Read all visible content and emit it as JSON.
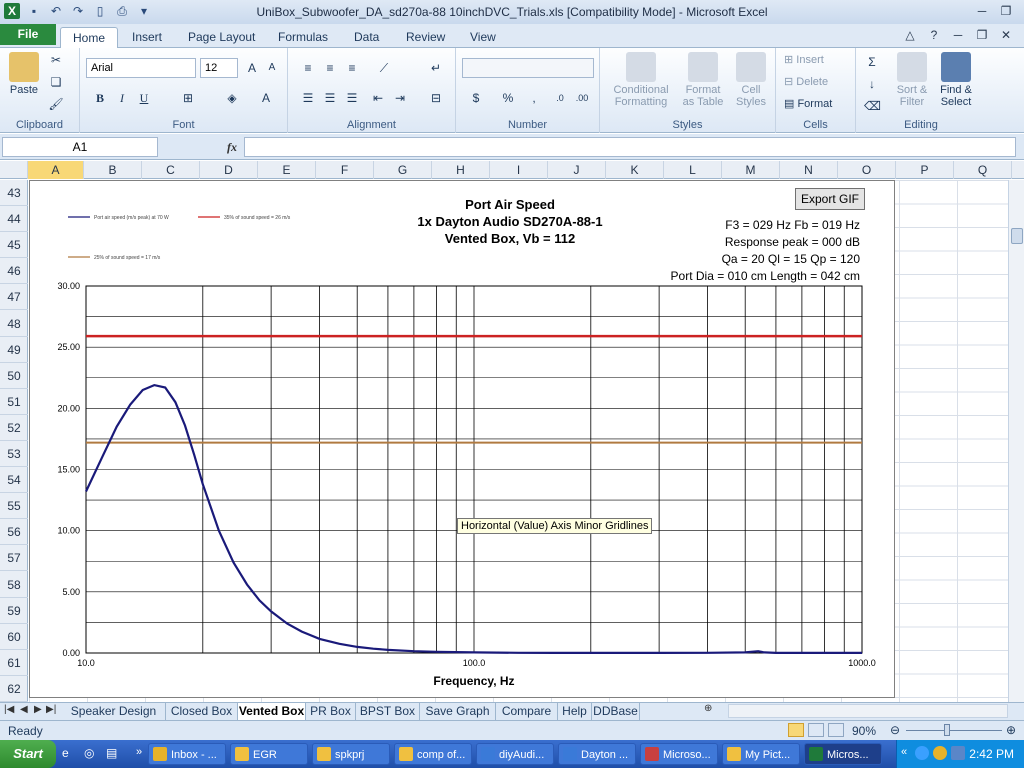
{
  "window": {
    "title": "UniBox_Subwoofer_DA_sd270a-88 10inchDVC_Trials.xls  [Compatibility Mode]  -  Microsoft Excel"
  },
  "ribbon_tabs": [
    "Home",
    "Insert",
    "Page Layout",
    "Formulas",
    "Data",
    "Review",
    "View"
  ],
  "file_tab": "File",
  "ribbon": {
    "clipboard": {
      "label": "Clipboard",
      "paste": "Paste"
    },
    "font": {
      "label": "Font",
      "name": "Arial",
      "size": "12",
      "bold": "B",
      "italic": "I",
      "underline": "U"
    },
    "alignment": {
      "label": "Alignment"
    },
    "number": {
      "label": "Number",
      "currency": "$",
      "percent": "%",
      "comma": ","
    },
    "styles": {
      "label": "Styles",
      "conditional": "Conditional",
      "conditional2": "Formatting",
      "format_table": "Format",
      "format_table2": "as Table",
      "cell_styles": "Cell",
      "cell_styles2": "Styles"
    },
    "cells": {
      "label": "Cells",
      "insert": "Insert",
      "delete": "Delete",
      "format": "Format"
    },
    "editing": {
      "label": "Editing",
      "sort": "Sort &",
      "sort2": "Filter",
      "find": "Find &",
      "find2": "Select",
      "sigma": "Σ"
    }
  },
  "formula_bar": {
    "name_box": "A1",
    "fx": "fx"
  },
  "columns": [
    "A",
    "B",
    "C",
    "D",
    "E",
    "F",
    "G",
    "H",
    "I",
    "J",
    "K",
    "L",
    "M",
    "N",
    "O",
    "P",
    "Q"
  ],
  "rows": [
    "43",
    "44",
    "45",
    "46",
    "47",
    "48",
    "49",
    "50",
    "51",
    "52",
    "53",
    "54",
    "55",
    "56",
    "57",
    "58",
    "59",
    "60",
    "61",
    "62"
  ],
  "chart": {
    "title_lines": [
      "Port Air Speed",
      "1x Dayton Audio SD270A-88-1",
      "Vented Box, Vb = 112"
    ],
    "export_button": "Export GIF",
    "params": [
      "F3 = 029 Hz  Fb = 019 Hz",
      "Response peak = 000 dB",
      "Qa = 20  Ql = 15  Qp = 120",
      "Port Dia = 010 cm   Length = 042 cm"
    ],
    "tooltip": "Horizontal (Value) Axis Minor Gridlines",
    "colors": {
      "curve": "#1a1a7a",
      "line26": "#cc2222",
      "line17": "#b07a40",
      "grid": "#000000"
    }
  },
  "chart_data": {
    "type": "line",
    "xlabel": "Frequency, Hz",
    "x_scale": "log",
    "xlim": [
      10,
      1000
    ],
    "ylim": [
      0,
      30
    ],
    "x_ticks": [
      "10.0",
      "100.0",
      "1000.0"
    ],
    "y_ticks": [
      "0.00",
      "5.00",
      "10.00",
      "15.00",
      "20.00",
      "25.00",
      "30.00"
    ],
    "legend": [
      "Port air speed (m/s peak) at 70 W",
      "35% of sound speed = 26 m/s",
      "25% of sound speed = 17 m/s"
    ],
    "series": [
      {
        "name": "Port air speed (m/s peak) at 70 W",
        "x": [
          10,
          11,
          12,
          13,
          14,
          15,
          16,
          17,
          18,
          19,
          20,
          22,
          24,
          26,
          28,
          30,
          33,
          36,
          40,
          45,
          50,
          55,
          60,
          70,
          80,
          100,
          130,
          160,
          200,
          250,
          300,
          400,
          500,
          540,
          560,
          600,
          700,
          1000
        ],
        "y": [
          13.2,
          16.0,
          18.5,
          20.3,
          21.5,
          21.9,
          21.7,
          20.5,
          18.6,
          16.2,
          13.8,
          10.0,
          7.4,
          5.6,
          4.3,
          3.4,
          2.4,
          1.75,
          1.15,
          0.75,
          0.5,
          0.35,
          0.25,
          0.15,
          0.1,
          0.05,
          0.02,
          0.01,
          0.01,
          0.01,
          0.01,
          0.02,
          0.05,
          0.15,
          0.05,
          0.01,
          0.01,
          0.01
        ]
      },
      {
        "name": "35% of sound speed = 26 m/s",
        "x": [
          10,
          1000
        ],
        "y": [
          25.9,
          25.9
        ]
      },
      {
        "name": "25% of sound speed = 17 m/s",
        "x": [
          10,
          1000
        ],
        "y": [
          17.2,
          17.2
        ]
      }
    ]
  },
  "sheet_tabs": [
    "Speaker Design",
    "Closed Box",
    "Vented Box",
    "PR Box",
    "BPST Box",
    "Save Graph",
    "Compare",
    "Help",
    "DDBase"
  ],
  "active_sheet": "Vented Box",
  "status": {
    "ready": "Ready",
    "zoom": "90%"
  },
  "taskbar": {
    "start": "Start",
    "items": [
      "Inbox - ...",
      "EGR",
      "spkprj",
      "comp of...",
      "diyAudi...",
      "Dayton ...",
      "Microso...",
      "My Pict...",
      "Micros..."
    ],
    "clock": "2:42 PM"
  }
}
